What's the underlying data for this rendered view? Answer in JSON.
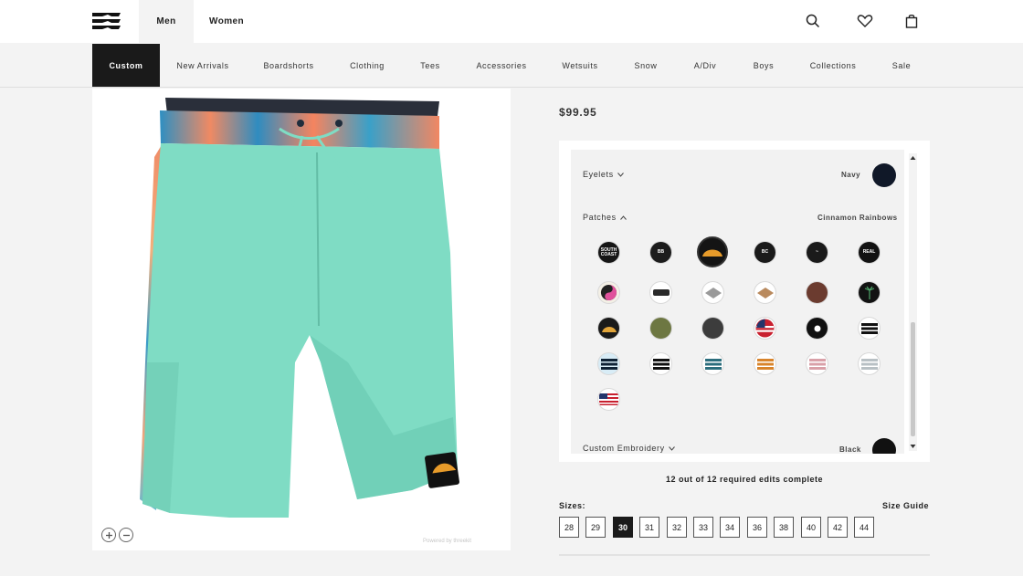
{
  "header": {
    "tabs": [
      {
        "label": "Men",
        "active": true
      },
      {
        "label": "Women",
        "active": false
      }
    ],
    "icons": [
      "search-icon",
      "heart-icon",
      "bag-icon"
    ]
  },
  "nav": {
    "items": [
      "Custom",
      "New Arrivals",
      "Boardshorts",
      "Clothing",
      "Tees",
      "Accessories",
      "Wetsuits",
      "Snow",
      "A/Div",
      "Boys",
      "Collections",
      "Sale"
    ],
    "active": "Custom"
  },
  "product": {
    "price": "$99.95",
    "image_alt": "Custom boardshorts preview"
  },
  "options": {
    "eyelets": {
      "label": "Eyelets",
      "value": "Navy",
      "color": "#101828"
    },
    "patches": {
      "label": "Patches",
      "value": "Cinnamon Rainbows",
      "items": [
        "patch-south-coast",
        "patch-classic-black",
        "patch-cinnamon-rainbows",
        "patch-bc-black",
        "patch-script-black",
        "patch-real",
        "patch-yin-yang",
        "patch-bone-logo",
        "patch-diamond-grey",
        "patch-diamond-tan",
        "patch-brown",
        "patch-palm",
        "patch-sunset-gold",
        "patch-olive",
        "patch-dark-pattern",
        "patch-us-flag-round",
        "patch-hand-black",
        "patch-wave-logo-white",
        "patch-wave-logo-blue",
        "patch-wave-logo-black-white",
        "patch-wave-logo-teal",
        "patch-wave-logo-orange",
        "patch-wave-logo-pink",
        "patch-wave-logo-grey",
        "patch-us-flag"
      ]
    },
    "embroidery": {
      "label": "Custom Embroidery",
      "value": "Black"
    }
  },
  "status": {
    "edits": "12 out of 12 required edits complete"
  },
  "sizes": {
    "label": "Sizes:",
    "guide": "Size Guide",
    "options": [
      "28",
      "29",
      "30",
      "31",
      "32",
      "33",
      "34",
      "36",
      "38",
      "40",
      "42",
      "44"
    ],
    "selected": "30"
  },
  "image_panel": {
    "powered_by": "Powered by threekit"
  },
  "colors": {
    "body": "#7fdcc4",
    "dark": "#1a1a1a"
  }
}
